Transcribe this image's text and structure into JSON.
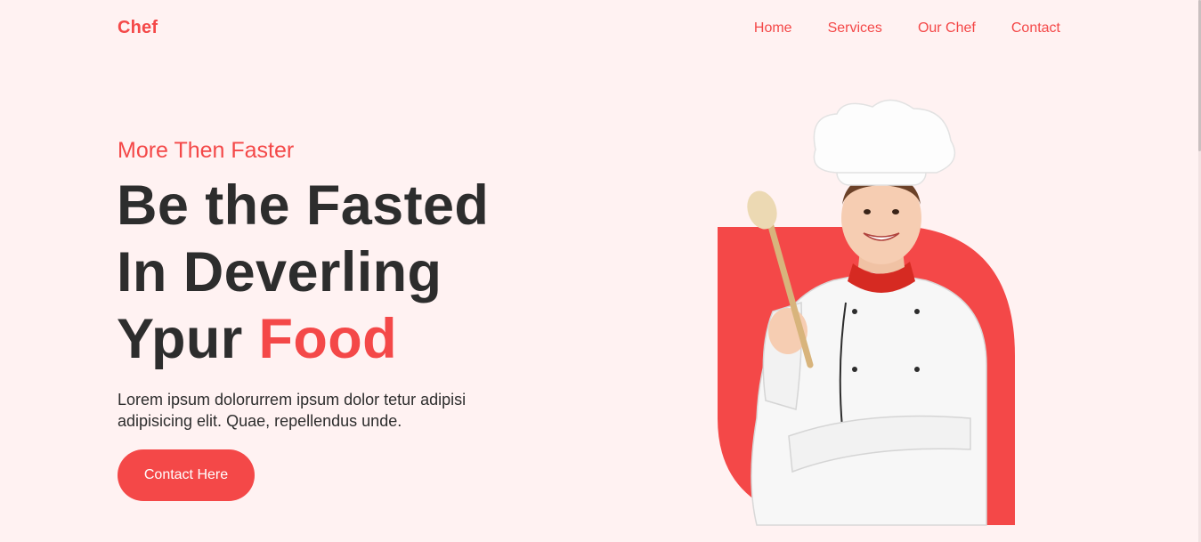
{
  "header": {
    "brand": "Chef",
    "nav": [
      "Home",
      "Services",
      "Our Chef",
      "Contact"
    ]
  },
  "hero": {
    "tagline": "More Then Faster",
    "headline_line1": "Be the Fasted",
    "headline_line2": "In Deverling",
    "headline_line3_prefix": "Ypur ",
    "headline_line3_accent": "Food",
    "description": "Lorem ipsum dolorurrem ipsum dolor tetur adipisi adipisicing elit. Quae, repellendus unde.",
    "cta_label": "Contact Here"
  },
  "colors": {
    "accent": "#f44848",
    "background": "#fff2f2",
    "text": "#2d2d2d"
  }
}
